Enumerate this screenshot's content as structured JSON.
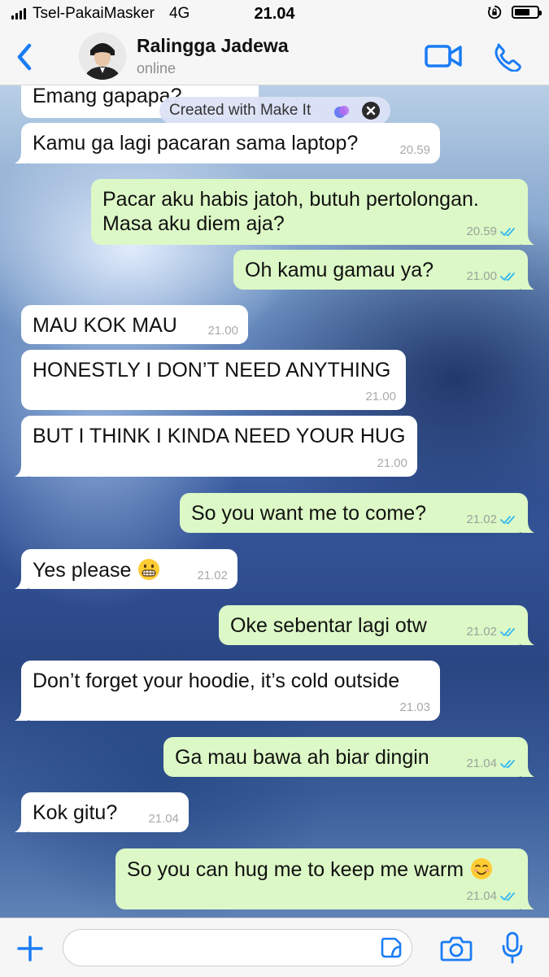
{
  "status_bar": {
    "carrier": "Tsel-PakaiMasker",
    "network": "4G",
    "time": "21.04"
  },
  "header": {
    "contact_name": "Ralingga Jadewa",
    "contact_status": "online"
  },
  "overlay": {
    "label": "Created with Make It"
  },
  "messages": [
    {
      "dir": "in",
      "text": "Emang gapapa?",
      "time": ""
    },
    {
      "dir": "in",
      "text": "Kamu ga lagi pacaran sama laptop?",
      "time": "20.59"
    },
    {
      "dir": "out",
      "text_lines": [
        "Pacar aku habis jatoh, butuh pertolongan.",
        "Masa aku diem aja?"
      ],
      "time": "20.59",
      "read": true
    },
    {
      "dir": "out",
      "text": "Oh kamu gamau ya?",
      "time": "21.00",
      "read": true
    },
    {
      "dir": "in",
      "text": "MAU KOK MAU",
      "time": "21.00"
    },
    {
      "dir": "in",
      "text": "HONESTLY I DON’T NEED ANYTHING",
      "time": "21.00"
    },
    {
      "dir": "in",
      "text": "BUT I THINK I KINDA NEED YOUR HUG",
      "time": "21.00"
    },
    {
      "dir": "out",
      "text": "So you want me to come?",
      "time": "21.02",
      "read": true
    },
    {
      "dir": "in",
      "text": "Yes please",
      "emoji": "grimacing-face",
      "time": "21.02"
    },
    {
      "dir": "out",
      "text": "Oke sebentar lagi otw",
      "time": "21.02",
      "read": true
    },
    {
      "dir": "in",
      "text": "Don’t forget your hoodie, it’s cold outside",
      "time": "21.03"
    },
    {
      "dir": "out",
      "text": "Ga mau bawa ah biar dingin",
      "time": "21.04",
      "read": true
    },
    {
      "dir": "in",
      "text": "Kok gitu?",
      "time": "21.04"
    },
    {
      "dir": "out",
      "text": "So you can hug me to keep me warm",
      "emoji": "smiling-face",
      "time": "21.04",
      "read": true
    }
  ],
  "composer": {
    "placeholder": ""
  },
  "colors": {
    "accent": "#1a7cf5",
    "incoming_bubble": "#ffffff",
    "outgoing_bubble": "#dcf8c6",
    "read_ticks": "#34b7f1"
  }
}
